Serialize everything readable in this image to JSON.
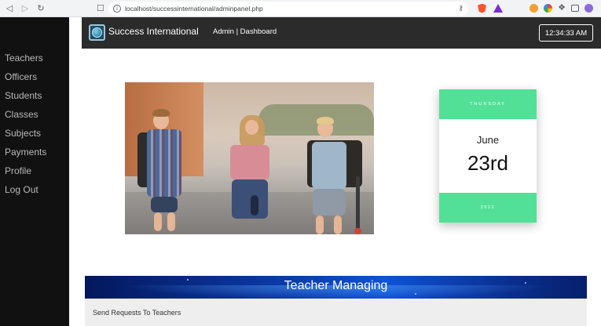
{
  "browser": {
    "url": "localhost/successinternational/adminpanel.php"
  },
  "sidebar": {
    "items": [
      {
        "label": "Teachers"
      },
      {
        "label": "Officers"
      },
      {
        "label": "Students"
      },
      {
        "label": "Classes"
      },
      {
        "label": "Subjects"
      },
      {
        "label": "Payments"
      },
      {
        "label": "Profile"
      },
      {
        "label": "Log Out"
      }
    ]
  },
  "header": {
    "brand": "Success International",
    "breadcrumb": "Admin | Dashboard",
    "time": "12:34:33 AM"
  },
  "calendar": {
    "weekday": "THURSDAY",
    "month": "June",
    "day": "23rd",
    "year": "2022",
    "accent_color": "#52e096"
  },
  "banner": {
    "title": "Teacher Managing"
  },
  "requests": {
    "label": "Send Requests To Teachers"
  },
  "colors": {
    "sidebar_bg": "#111111",
    "header_bg": "#2b2b2b",
    "banner_bg": "#0b3aa8"
  }
}
